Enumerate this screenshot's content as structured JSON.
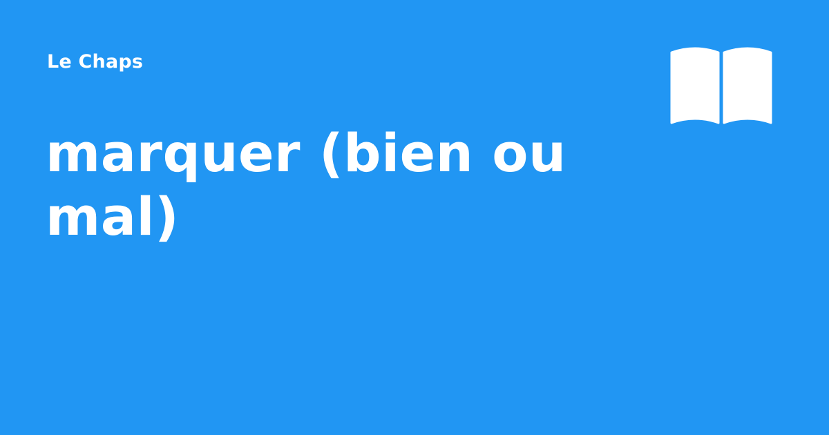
{
  "site": {
    "name": "Le Chaps"
  },
  "page": {
    "title": "marquer (bien ou mal)"
  },
  "logo": {
    "icon": "open-book-icon"
  },
  "colors": {
    "background": "#2196F3",
    "text": "#FFFFFF"
  }
}
